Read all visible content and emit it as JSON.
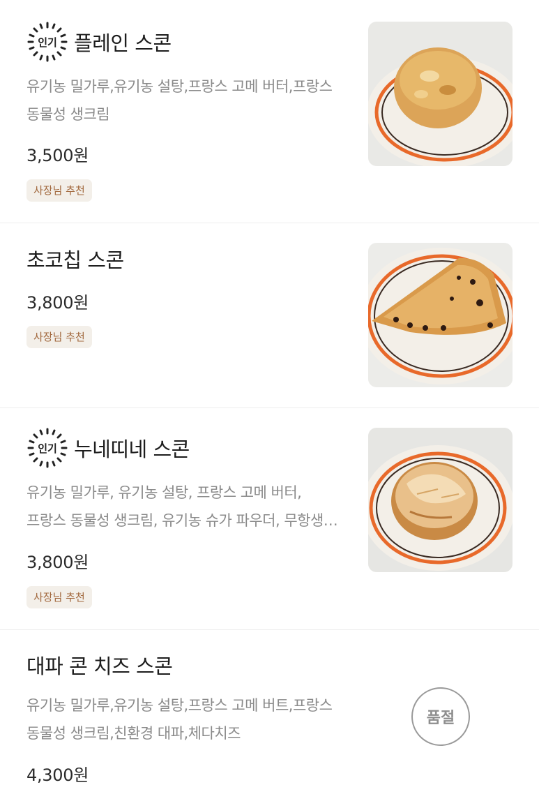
{
  "menu": {
    "items": [
      {
        "badge": "인기",
        "name": "플레인 스콘",
        "desc_lines": [
          "유기농 밀가루,유기농 설탕,프랑스 고메 버터,프랑스",
          "동물성 생크림"
        ],
        "price": "3,500원",
        "tag": "사장님 추천",
        "image": "plain-scone-on-plate"
      },
      {
        "name": "초코칩 스콘",
        "price": "3,800원",
        "tag": "사장님 추천",
        "image": "choco-chip-scone-on-plate"
      },
      {
        "badge": "인기",
        "name": "누네띠네 스콘",
        "desc_lines": [
          "유기농 밀가루, 유기농 설탕, 프랑스 고메 버터,",
          "프랑스 동물성 생크림, 유기농 슈가 파우더, 무항생…"
        ],
        "price": "3,800원",
        "tag": "사장님 추천",
        "image": "nunettine-scone-on-plate"
      },
      {
        "name": "대파 콘 치즈 스콘",
        "desc_lines": [
          "유기농 밀가루,유기농 설탕,프랑스 고메 버트,프랑스",
          "동물성 생크림,친환경 대파,체다치즈"
        ],
        "price": "4,300원",
        "status": "품절"
      }
    ]
  },
  "colors": {
    "tag_bg": "#f3efe9",
    "tag_text": "#a1673c",
    "plate_rim": "#e8692a",
    "desc_text": "#8a8a8a"
  }
}
